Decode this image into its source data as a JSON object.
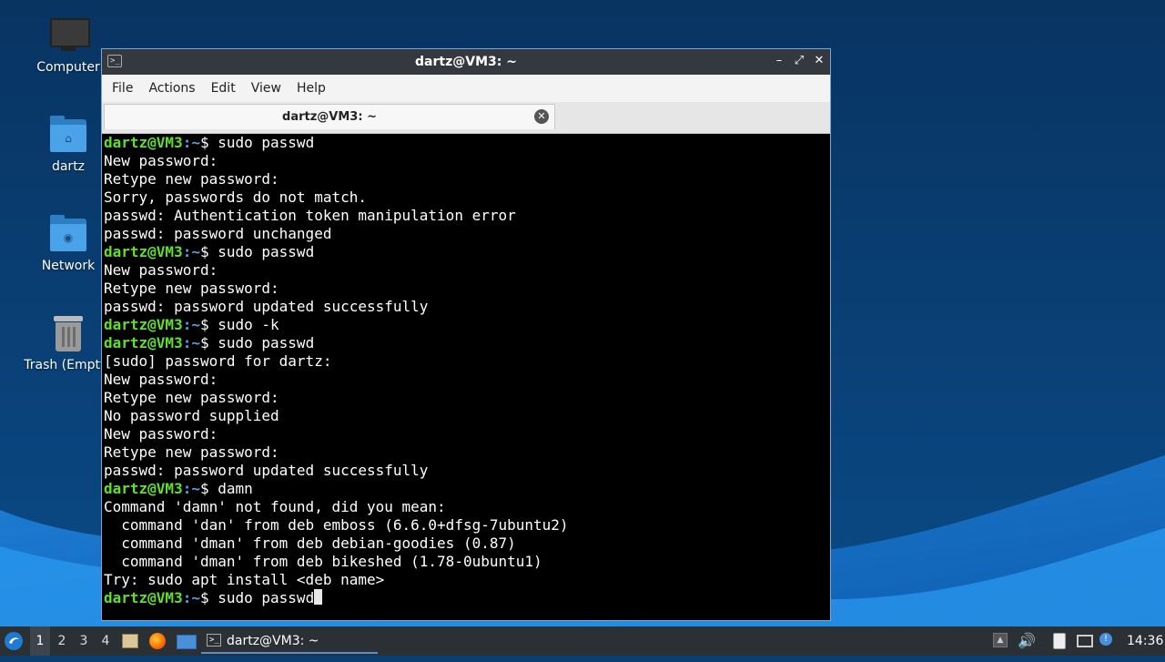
{
  "desktop": {
    "icons": [
      {
        "label": "Computer",
        "icon": "monitor-icon"
      },
      {
        "label": "dartz",
        "icon": "home-folder-icon"
      },
      {
        "label": "Network",
        "icon": "network-folder-icon"
      },
      {
        "label": "Trash (Empty)",
        "icon": "trash-icon"
      }
    ]
  },
  "window": {
    "title": "dartz@VM3: ~",
    "menu": [
      "File",
      "Actions",
      "Edit",
      "View",
      "Help"
    ],
    "tab_title": "dartz@VM3: ~"
  },
  "terminal": {
    "prompt_user": "dartz@VM3",
    "prompt_path": ":~",
    "prompt_sign": "$ ",
    "lines": [
      {
        "type": "cmd",
        "text": "sudo passwd"
      },
      {
        "type": "out",
        "text": "New password:"
      },
      {
        "type": "out",
        "text": "Retype new password:"
      },
      {
        "type": "out",
        "text": "Sorry, passwords do not match."
      },
      {
        "type": "out",
        "text": "passwd: Authentication token manipulation error"
      },
      {
        "type": "out",
        "text": "passwd: password unchanged"
      },
      {
        "type": "cmd",
        "text": "sudo passwd"
      },
      {
        "type": "out",
        "text": "New password:"
      },
      {
        "type": "out",
        "text": "Retype new password:"
      },
      {
        "type": "out",
        "text": "passwd: password updated successfully"
      },
      {
        "type": "cmd",
        "text": "sudo -k"
      },
      {
        "type": "cmd",
        "text": "sudo passwd"
      },
      {
        "type": "out",
        "text": "[sudo] password for dartz:"
      },
      {
        "type": "out",
        "text": "New password:"
      },
      {
        "type": "out",
        "text": "Retype new password:"
      },
      {
        "type": "out",
        "text": "No password supplied"
      },
      {
        "type": "out",
        "text": "New password:"
      },
      {
        "type": "out",
        "text": "Retype new password:"
      },
      {
        "type": "out",
        "text": "passwd: password updated successfully"
      },
      {
        "type": "cmd",
        "text": "damn"
      },
      {
        "type": "out",
        "text": "Command 'damn' not found, did you mean:"
      },
      {
        "type": "out",
        "text": "  command 'dan' from deb emboss (6.6.0+dfsg-7ubuntu2)"
      },
      {
        "type": "out",
        "text": "  command 'dman' from deb debian-goodies (0.87)"
      },
      {
        "type": "out",
        "text": "  command 'dman' from deb bikeshed (1.78-0ubuntu1)"
      },
      {
        "type": "out",
        "text": "Try: sudo apt install <deb name>"
      },
      {
        "type": "cmd",
        "text": "sudo passwd",
        "cursor": true
      }
    ]
  },
  "taskbar": {
    "workspaces": [
      "1",
      "2",
      "3",
      "4"
    ],
    "active_workspace": "1",
    "task_label": "dartz@VM3: ~",
    "clock": "14:36"
  },
  "colors": {
    "prompt_user": "#5fe02b",
    "prompt_path": "#5c9fe0",
    "desktop": "#0a3f73"
  }
}
